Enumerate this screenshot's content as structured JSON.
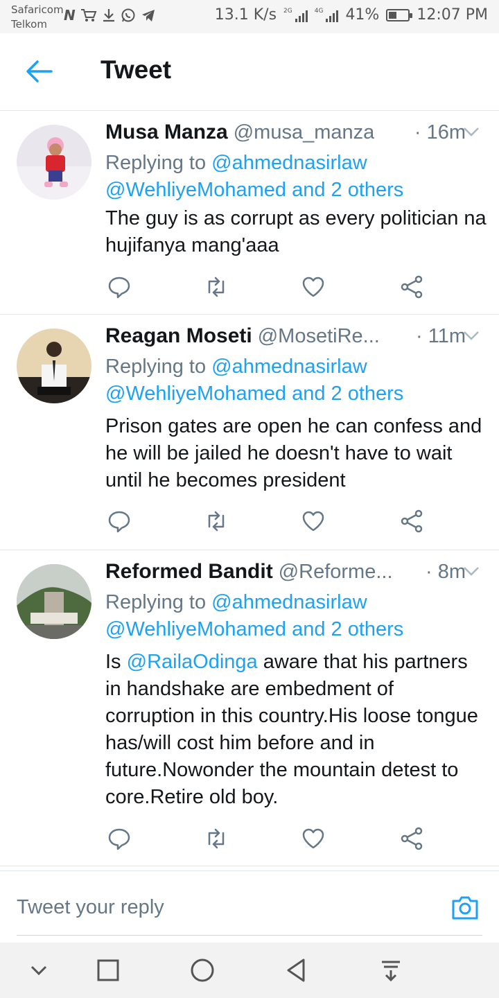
{
  "status_bar": {
    "carrier1": "Safaricom",
    "carrier2": "Telkom",
    "speed": "13.1 K/s",
    "net1": "2G",
    "net2": "4G",
    "battery": "41%",
    "battery_level": 0.41,
    "time": "12:07 PM"
  },
  "header": {
    "title": "Tweet"
  },
  "tweets": [
    {
      "name": "Musa Manza",
      "handle": "@musa_manza",
      "time": "· 16m",
      "replying_prefix": "Replying to",
      "replying_to1": "@ahmednasirlaw",
      "replying_to2": "@WehliyeMohamed and 2 others",
      "text": "The guy is as corrupt as every politician na hujifanya mang'aaa"
    },
    {
      "name": "Reagan Moseti",
      "handle": "@MosetiRe...",
      "time": "· 11m",
      "replying_prefix": "Replying to",
      "replying_to1": "@ahmednasirlaw",
      "replying_to2": "@WehliyeMohamed and 2 others",
      "text": "Prison gates are open he can confess and he will be jailed he doesn't have to wait until he becomes president"
    },
    {
      "name": "Reformed Bandit",
      "handle": "@Reforme...",
      "time": "· 8m",
      "replying_prefix": "Replying to",
      "replying_to1": "@ahmednasirlaw",
      "replying_to2": "@WehliyeMohamed and 2 others",
      "text_mention": "@RailaOdinga",
      "text": "aware that his partners in handshake are embedment of corruption in this country.His loose tongue has/will cost him before and in future.Nowonder the mountain detest to core.Retire old boy.",
      "text_prefix": "Is"
    }
  ],
  "composer": {
    "placeholder": "Tweet your reply"
  },
  "colors": {
    "accent": "#1da1f2",
    "text": "#14171a",
    "muted": "#657786",
    "divider": "#e1e8ed"
  }
}
